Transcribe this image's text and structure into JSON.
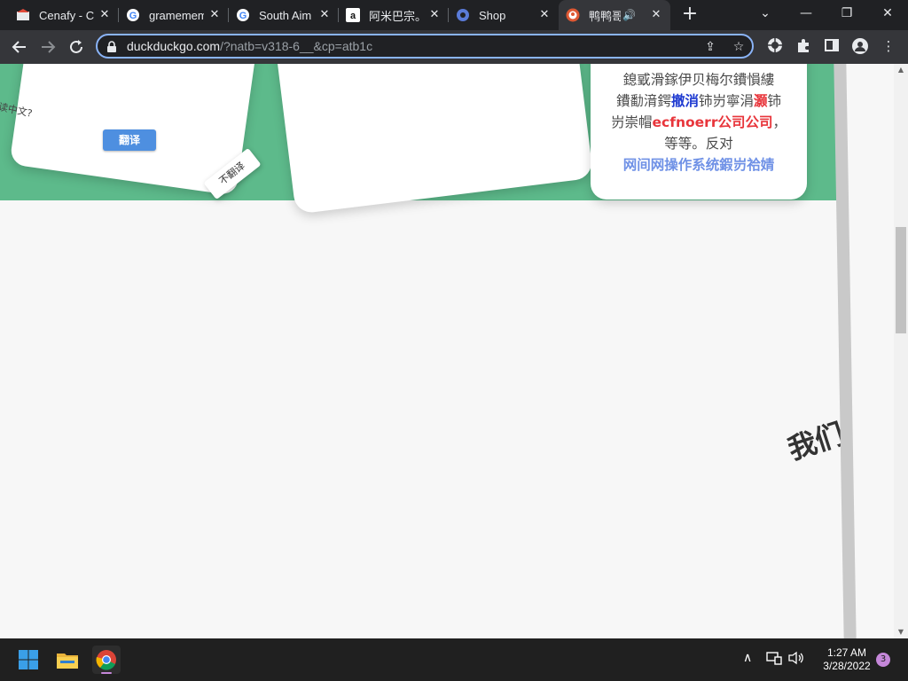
{
  "browser": {
    "tabs": [
      {
        "title": "Cenafy - Ch",
        "icon": "cenafy-icon",
        "active": false
      },
      {
        "title": "gramemem",
        "icon": "google-icon",
        "active": false
      },
      {
        "title": "South Aim",
        "icon": "google-icon",
        "active": false
      },
      {
        "title": "阿米巴宗。",
        "icon": "amazon-icon",
        "active": false
      },
      {
        "title": "Shop",
        "icon": "shop-icon",
        "active": false
      },
      {
        "title": "鸭鸭哥",
        "icon": "duckduckgo-icon",
        "active": true,
        "audio": true
      }
    ],
    "new_tab": "+",
    "window_controls": {
      "chevron": "⌄",
      "minimize": "—",
      "restore": "❐",
      "close": "✕"
    },
    "url_host": "duckduckgo.com",
    "url_path": "/?natb=v318-6__&cp=atb1c"
  },
  "page": {
    "side_text": "读中文?",
    "translate_button": "翻译",
    "no_translate": "不翻译",
    "card3": {
      "line1": "鎴戜滑鎵伊贝梅尔鐨愪縷",
      "line2a": "鐨勫湇鍔",
      "line2_blue": "撤消",
      "line2b": "铈岃寧涓",
      "line2_red": "灏",
      "line2c": "铈",
      "line3a": "岃崇帽",
      "line3_red": "ecfnoerr公司公司",
      "line3b": "，",
      "line4": "等等。反对",
      "line5_blue": "网间网操作系统鍜岃祫婧"
    },
    "big_text": "我们"
  },
  "taskbar": {
    "time": "1:27 AM",
    "date": "3/28/2022",
    "notifications": "3"
  },
  "colors": {
    "green_band": "#5dba8b",
    "accent_blue": "#4e8fe0",
    "omnibox_border": "#8ab4f8"
  }
}
